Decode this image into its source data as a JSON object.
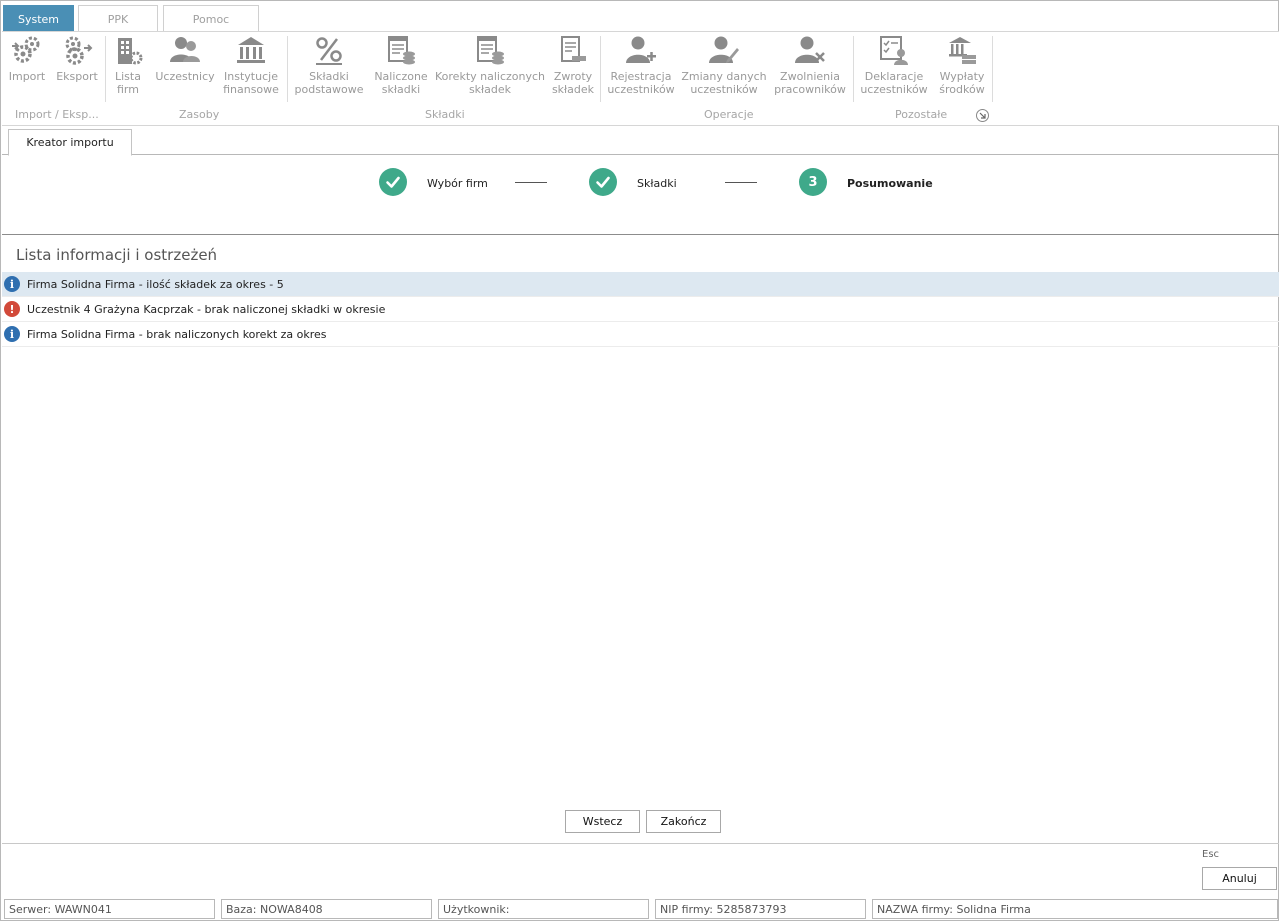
{
  "menu_tabs": [
    {
      "label": "System",
      "active": true
    },
    {
      "label": "PPK",
      "active": false
    },
    {
      "label": "Pomoc",
      "active": false
    }
  ],
  "ribbon": {
    "buttons": {
      "import": {
        "line1": "Import",
        "line2": ""
      },
      "eksport": {
        "line1": "Eksport",
        "line2": ""
      },
      "lista_firm": {
        "line1": "Lista",
        "line2": "firm"
      },
      "uczestnicy": {
        "line1": "Uczestnicy",
        "line2": ""
      },
      "instytucje": {
        "line1": "Instytucje",
        "line2": "finansowe"
      },
      "skladki_podst": {
        "line1": "Składki",
        "line2": "podstawowe"
      },
      "naliczone": {
        "line1": "Naliczone",
        "line2": "składki"
      },
      "korekty": {
        "line1": "Korekty naliczonych",
        "line2": "składek"
      },
      "zwroty": {
        "line1": "Zwroty",
        "line2": "składek"
      },
      "rejestracja": {
        "line1": "Rejestracja",
        "line2": "uczestników"
      },
      "zmiany": {
        "line1": "Zmiany danych",
        "line2": "uczestników"
      },
      "zwolnienia": {
        "line1": "Zwolnienia",
        "line2": "pracowników"
      },
      "deklaracje": {
        "line1": "Deklaracje",
        "line2": "uczestników"
      },
      "wyplaty": {
        "line1": "Wypłaty",
        "line2": "środków"
      }
    },
    "groups": {
      "import_eksp": "Import / Eksp...",
      "zasoby": "Zasoby",
      "skladki": "Składki",
      "operacje": "Operacje",
      "pozostale": "Pozostałe"
    },
    "icon_color": "#8a8a8a"
  },
  "doc_tab": {
    "label": "Kreator importu"
  },
  "wizard": {
    "steps": [
      {
        "label": "Wybór firm",
        "state": "done",
        "marker": ""
      },
      {
        "label": "Składki",
        "state": "done",
        "marker": ""
      },
      {
        "label": "Posumowanie",
        "state": "current",
        "marker": "3"
      }
    ],
    "accent": "#3fa98a"
  },
  "list": {
    "title": "Lista informacji i ostrzeżeń",
    "items": [
      {
        "type": "info",
        "text": "Firma Solidna Firma - ilość składek za okres - 5",
        "selected": true
      },
      {
        "type": "warning",
        "text": "Uczestnik 4 Grażyna Kacprzak - brak naliczonej składki w okresie",
        "selected": false
      },
      {
        "type": "info",
        "text": "Firma Solidna Firma - brak naliczonych korekt za okres",
        "selected": false
      }
    ]
  },
  "buttons": {
    "back": "Wstecz",
    "finish": "Zakończ",
    "cancel": "Anuluj",
    "esc_hint": "Esc"
  },
  "status_bar": {
    "server": "Serwer: WAWN041",
    "database": "Baza: NOWA8408",
    "user": "Użytkownik:",
    "nip": "NIP firmy: 5285873793",
    "company": "NAZWA firmy: Solidna Firma"
  }
}
